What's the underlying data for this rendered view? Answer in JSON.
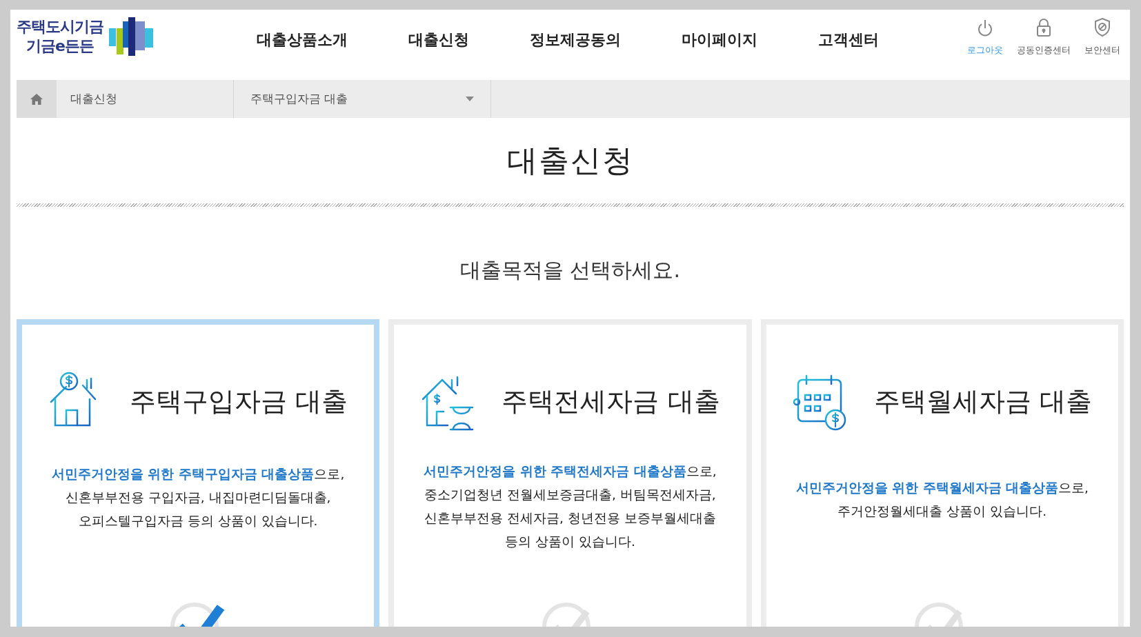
{
  "header": {
    "logo": {
      "lines": [
        "주택도시기금",
        "기금e든든"
      ]
    },
    "nav": [
      "대출상품소개",
      "대출신청",
      "정보제공동의",
      "마이페이지",
      "고객센터"
    ],
    "utility": [
      {
        "kind": "power",
        "label": "로그아웃",
        "highlighted": true
      },
      {
        "kind": "lock",
        "label": "공동인증센터",
        "highlighted": false
      },
      {
        "kind": "shield",
        "label": "보안센터",
        "highlighted": false
      }
    ]
  },
  "breadcrumb": {
    "current": "대출신청",
    "dropdown": {
      "value": "주택구입자금 대출"
    }
  },
  "page_title": "대출신청",
  "prompt": "대출목적을 선택하세요.",
  "cards": [
    {
      "kind": "purchase",
      "title": "주택구입자금 대출",
      "selected": true,
      "description": [
        "**서민주거안정을 위한 주택구입자금 대출상품**으로,",
        "신혼부부전용 구입자금, 내집마련디딤돌대출,",
        "오피스텔구입자금 등의 상품이 있습니다."
      ]
    },
    {
      "kind": "jeonse",
      "title": "주택전세자금 대출",
      "selected": false,
      "description": [
        "**서민주거안정을 위한 주택전세자금 대출상품**으로,",
        "중소기업청년 전월세보증금대출, 버팀목전세자금,",
        "신혼부부전용 전세자금, 청년전용 보증부월세대출",
        "등의 상품이 있습니다."
      ]
    },
    {
      "kind": "monthly",
      "title": "주택월세자금 대출",
      "selected": false,
      "description": [
        "**서민주거안정을 위한 주택월세자금 대출상품**으로,",
        "주거안정월세대출 상품이 있습니다."
      ]
    }
  ]
}
